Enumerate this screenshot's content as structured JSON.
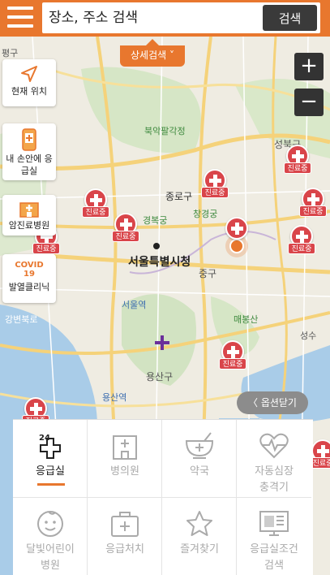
{
  "search": {
    "placeholder": "장소, 주소 검색",
    "button": "검색"
  },
  "detail_search": "상세검색 ˅",
  "side_buttons": [
    {
      "label": "현재 위치"
    },
    {
      "label": "내 손안에 응급실"
    },
    {
      "label": "암진료병원"
    },
    {
      "label": "발열클리닉",
      "badge_top": "COVID",
      "badge_bottom": "19"
    }
  ],
  "zoom": {
    "in": "+",
    "out": "−"
  },
  "option_close": "〈 옵션닫기",
  "pin_tag": "진료중",
  "map_labels": {
    "pyeong": "평구",
    "bukak": "북악팔각정",
    "jongno": "종로구",
    "changgyeong": "창경궁",
    "gyeongbok": "경복궁",
    "cityhall": "서울특별시청",
    "junggu": "중구",
    "seoul_station": "서울역",
    "yongsan_gu": "용산구",
    "yongsan_station": "용산역",
    "maebong": "매봉산",
    "seongbuk": "성북구",
    "gangbyeon": "강변북로",
    "seongsu": "성수"
  },
  "menu": [
    {
      "label": "응급실",
      "icon": "emergency-24-icon",
      "active": true
    },
    {
      "label": "병의원",
      "icon": "hospital-building-icon",
      "active": false
    },
    {
      "label": "약국",
      "icon": "pharmacy-bowl-icon",
      "active": false
    },
    {
      "label": "자동심장 충격기",
      "line1": "자동심장",
      "line2": "충격기",
      "icon": "heart-pulse-icon",
      "active": false
    },
    {
      "label": "달빛어린이 병원",
      "line1": "달빛어린이",
      "line2": "병원",
      "icon": "child-face-icon",
      "active": false
    },
    {
      "label": "응급처치",
      "icon": "first-aid-kit-icon",
      "active": false
    },
    {
      "label": "즐겨찾기",
      "icon": "star-icon",
      "active": false
    },
    {
      "label": "응급실조건 검색",
      "line1": "응급실조건",
      "line2": "검색",
      "icon": "monitor-icon",
      "active": false
    }
  ],
  "colors": {
    "brand": "#e8772e",
    "pin": "#d9454a",
    "dark": "#333333"
  }
}
